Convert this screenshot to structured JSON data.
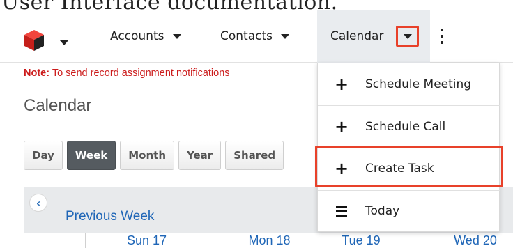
{
  "doc": {
    "heading": "User Interface documentation."
  },
  "nav": {
    "accounts_label": "Accounts",
    "contacts_label": "Contacts",
    "calendar_label": "Calendar"
  },
  "note": {
    "prefix": "Note:",
    "text": " To send record assignment notifications"
  },
  "page": {
    "title": "Calendar"
  },
  "views": [
    "Day",
    "Week",
    "Month",
    "Year",
    "Shared"
  ],
  "active_view": "Week",
  "calendar": {
    "prev_label": "Previous Week",
    "days": [
      "Sun 17",
      "Mon 18",
      "Tue 19",
      "Wed 20"
    ]
  },
  "menu": {
    "items": [
      {
        "icon": "plus-icon",
        "label": "Schedule Meeting"
      },
      {
        "icon": "plus-icon",
        "label": "Schedule Call"
      },
      {
        "icon": "plus-icon",
        "label": "Create Task"
      },
      {
        "icon": "list-icon",
        "label": "Today"
      }
    ],
    "highlighted": "Create Task"
  },
  "colors": {
    "highlight": "#e8412a",
    "link": "#1f66b7",
    "note": "#cc1c1c"
  }
}
